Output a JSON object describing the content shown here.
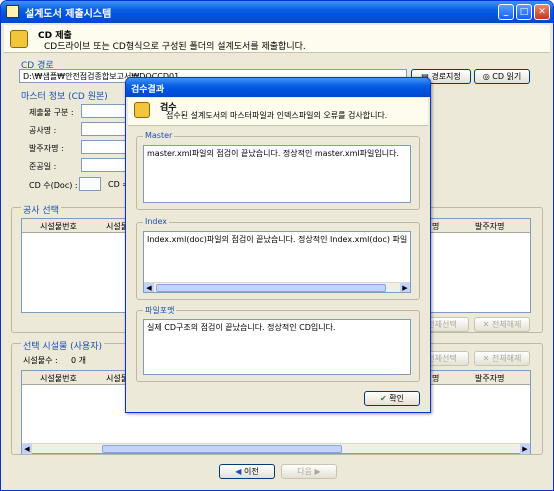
{
  "window": {
    "title": "설계도서 제출시스템"
  },
  "header": {
    "title": "CD 제출",
    "subtitle": "CD드라이브 또는 CD형식으로 구성된 폴더의 설계도서를 제출합니다."
  },
  "cd_path": {
    "section": "CD 경로",
    "value": "D:\\₩샘플₩안전점검종합보고서₩DOCCD01",
    "set_path_button": "경로지정",
    "read_cd_button": "CD 읽기"
  },
  "master": {
    "section": "마스터 정보 (CD 원본)",
    "labels": [
      "제출물 구분 :",
      "공사명 :",
      "발주자명 :",
      "준공일 :",
      "CD 수(Doc) :",
      "CD ="
    ]
  },
  "project": {
    "section": "공사 선택",
    "columns": [
      "시설물번호",
      "시설물",
      "발주자명"
    ],
    "right_cols": [
      "명",
      "발주자명"
    ],
    "select_all": "전체선택",
    "deselect_all": "전체해제"
  },
  "selected": {
    "section": "선택 시설물 (사용자)",
    "count_label": "시설물수 :",
    "count_value": "0 개",
    "columns": [
      "시설물번호",
      "시설물"
    ],
    "right_cols": [
      "명",
      "발주자명"
    ],
    "select_all": "전체선택",
    "deselect_all": "전체해제"
  },
  "footer": {
    "prev": "이전",
    "next": "다음"
  },
  "dialog": {
    "title": "검수결과",
    "heading": "검수",
    "subtitle": "접수된 설계도서의 마스터파일과 인덱스파일의 오류를 검사합니다.",
    "groups": [
      {
        "label": "Master",
        "text": "master.xml파일의 점검이 끝났습니다. 정상적인 master.xml파일입니다."
      },
      {
        "label": "Index",
        "text": "Index.xml(doc)파일의 점검이 끝났습니다. 정상적인 Index.xml(doc) 파일"
      },
      {
        "label": "파일포맷",
        "text": "실제 CD구조의 점검이 끝났습니다. 정상적인 CD입니다."
      }
    ],
    "ok": "확인"
  }
}
